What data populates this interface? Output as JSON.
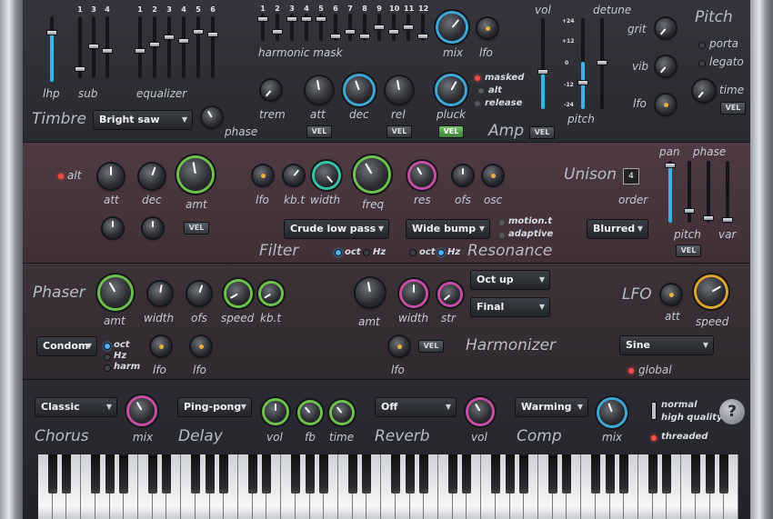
{
  "timbre": {
    "title": "Timbre",
    "slider_labels": {
      "lhp": "lhp",
      "sub": "sub",
      "equalizer": "equalizer"
    },
    "sub_numbers": [
      "1",
      "3",
      "4"
    ],
    "eq_numbers": [
      "1",
      "2",
      "3",
      "4",
      "5",
      "6"
    ],
    "preset": "Bright saw",
    "phase_label": "phase"
  },
  "harmonic": {
    "numbers": [
      "1",
      "2",
      "3",
      "4",
      "5",
      "6",
      "7",
      "8",
      "9",
      "10",
      "11",
      "12"
    ],
    "label": "harmonic mask",
    "mix_label": "mix",
    "lfo_label": "lfo"
  },
  "amp": {
    "title": "Amp",
    "trem": "trem",
    "att": "att",
    "dec": "dec",
    "rel": "rel",
    "pluck": "pluck",
    "vel": "VEL",
    "options": [
      "masked",
      "alt",
      "release"
    ]
  },
  "vol_label": "vol",
  "pitch_section": {
    "detune": "detune",
    "title": "Pitch",
    "grit": "grit",
    "vib": "vib",
    "lfo": "lfo",
    "time": "time",
    "pitch": "pitch",
    "porta": "porta",
    "legato": "legato",
    "vel": "VEL",
    "scale": [
      "+24",
      "+12",
      "0",
      "-12",
      "-24"
    ]
  },
  "filter": {
    "title": "Filter",
    "alt": "alt",
    "att": "att",
    "dec": "dec",
    "amt": "amt",
    "lfo": "lfo",
    "kbt": "kb.t",
    "width": "width",
    "freq": "freq",
    "res": "res",
    "ofs": "ofs",
    "osc": "osc",
    "vel": "VEL",
    "type": "Crude low pass",
    "oct": "oct",
    "hz": "Hz"
  },
  "resonance": {
    "title": "Resonance",
    "type": "Wide bump",
    "motion": "motion.t",
    "adaptive": "adaptive",
    "oct": "oct",
    "hz": "Hz"
  },
  "unison": {
    "title": "Unison",
    "order_label": "order",
    "order_value": "4",
    "mode": "Blurred",
    "pan": "pan",
    "phase": "phase",
    "pitch": "pitch",
    "var": "var",
    "vel": "VEL"
  },
  "phaser": {
    "title": "Phaser",
    "amt": "amt",
    "width": "width",
    "ofs": "ofs",
    "speed": "speed",
    "kbt": "kb.t",
    "mode": "Condom",
    "units": [
      "oct",
      "Hz",
      "harm"
    ],
    "lfo1": "lfo",
    "lfo2": "lfo"
  },
  "harmonizer": {
    "title": "Harmonizer",
    "amt": "amt",
    "width": "width",
    "str": "str",
    "mode1": "Oct up",
    "mode2": "Final",
    "vel": "VEL",
    "lfo": "lfo"
  },
  "lfo": {
    "title": "LFO",
    "att": "att",
    "speed": "speed",
    "shape": "Sine",
    "global": "global"
  },
  "chorus": {
    "title": "Chorus",
    "mode": "Classic",
    "mix": "mix"
  },
  "delay": {
    "title": "Delay",
    "mode": "Ping-pong",
    "vol": "vol",
    "fb": "fb",
    "time": "time"
  },
  "reverb": {
    "title": "Reverb",
    "mode": "Off",
    "vol": "vol"
  },
  "comp": {
    "title": "Comp",
    "mode": "Warming",
    "mix": "mix"
  },
  "quality": {
    "normal": "normal",
    "high": "high quality",
    "threaded": "threaded"
  },
  "help": "?",
  "colors": {
    "blue": "#3fa7d6",
    "green": "#6cc24a",
    "magenta": "#c64ea3",
    "teal": "#36c2a6",
    "yellow": "#e0a52a",
    "led": "#ff4a4a"
  }
}
